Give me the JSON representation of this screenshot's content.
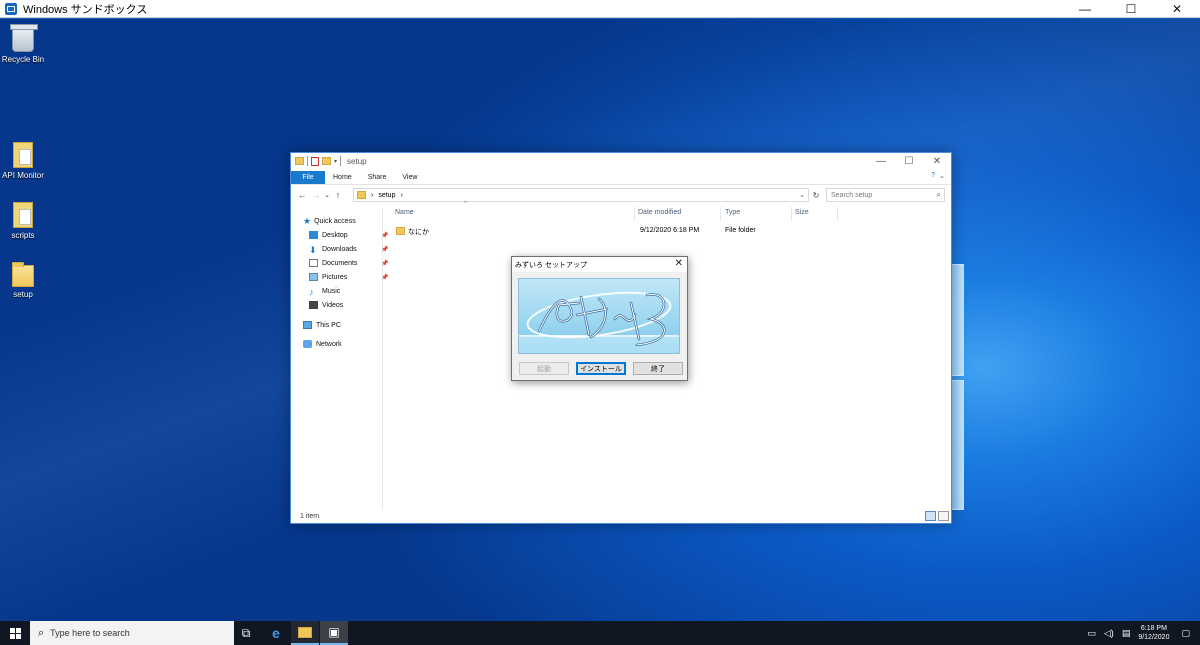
{
  "sandbox": {
    "title": "Windows サンドボックス",
    "minimize": "—",
    "maximize": "☐",
    "close": "✕"
  },
  "desktop_icons": [
    {
      "label": "Recycle Bin",
      "icon": "recycle-bin-icon"
    },
    {
      "label": "API Monitor",
      "icon": "document-icon"
    },
    {
      "label": "scripts",
      "icon": "document-icon"
    },
    {
      "label": "setup",
      "icon": "folder-icon"
    }
  ],
  "explorer": {
    "title": "setup",
    "tabs": [
      "File",
      "Home",
      "Share",
      "View"
    ],
    "ribbon_expand": "⌄",
    "help": "?",
    "nav": {
      "back": "←",
      "forward": "→",
      "recent": "⌄",
      "up": "↑"
    },
    "address": {
      "sep1": "›",
      "folder": "setup",
      "sep2": "›",
      "dropdown": "⌄"
    },
    "refresh": "↻",
    "search_placeholder": "Search setup",
    "navpane": {
      "quick_access": "Quick access",
      "items": [
        "Desktop",
        "Downloads",
        "Documents",
        "Pictures",
        "Music",
        "Videos"
      ],
      "pin": "📌",
      "this_pc": "This PC",
      "network": "Network"
    },
    "columns": {
      "name": "Name",
      "date": "Date modified",
      "type": "Type",
      "size": "Size"
    },
    "sort_indicator": "^",
    "rows": [
      {
        "name": "なにか",
        "date": "9/12/2020 6:18 PM",
        "type": "File folder",
        "size": ""
      }
    ],
    "status": "1 item"
  },
  "dialog": {
    "title": "みずいろ セットアップ",
    "close": "✕",
    "buttons": {
      "launch": "起動",
      "install": "インストール",
      "exit": "終了"
    }
  },
  "taskbar": {
    "search_placeholder": "Type here to search",
    "time": "6:18 PM",
    "date": "9/12/2020"
  },
  "colors": {
    "accent": "#1979ca",
    "desktop": "#0a5bc4",
    "taskbar": "#101622"
  }
}
